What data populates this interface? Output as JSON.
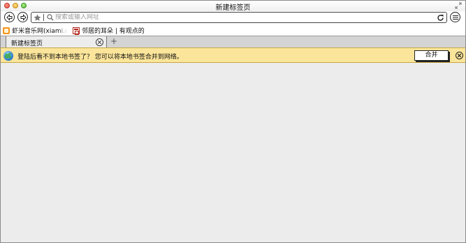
{
  "window": {
    "title": "新建标签页"
  },
  "toolbar": {
    "back_icon": "back-arrow-icon",
    "forward_icon": "forward-arrow-icon",
    "url_placeholder": "搜索或输入网址",
    "url_value": "",
    "reload_icon": "reload-icon",
    "menu_icon": "menu-icon"
  },
  "bookmarks": [
    {
      "label": "虾米音乐网(xiami.com",
      "icon": "xiami-icon"
    },
    {
      "label": "邻居的耳朵 | 有观点的",
      "icon": "douban-icon"
    }
  ],
  "tabs": [
    {
      "title": "新建标签页",
      "active": true
    }
  ],
  "new_tab_label": "+",
  "notification": {
    "text": "登陆后看不到本地书签了？ 您可以将本地书签合并到网络。",
    "button_label": "合并",
    "icon": "globe-icon"
  },
  "colors": {
    "notification_bg": "#fbe59a",
    "content_bg": "#ececec",
    "tabstrip_bg": "#d4d4d4"
  }
}
